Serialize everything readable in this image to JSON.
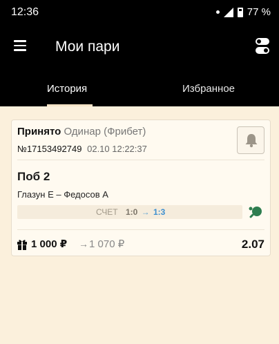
{
  "status_bar": {
    "time": "12:36",
    "battery": "77 %"
  },
  "header": {
    "title": "Мои пари"
  },
  "tabs": [
    {
      "label": "История",
      "active": true
    },
    {
      "label": "Избранное",
      "active": false
    }
  ],
  "bet": {
    "status": "Принято",
    "type": "Одинар (Фрибет)",
    "number": "№17153492749",
    "datetime": "02.10 12:22:37",
    "outcome": "Поб 2",
    "match": "Глазун Е – Федосов А",
    "score_label": "СЧЕТ",
    "score_old": "1:0",
    "score_arrow": "→",
    "score_new": "1:3",
    "stake": "1 000 ₽",
    "payout_arrow": "→",
    "payout": "1 070 ₽",
    "odds": "2.07"
  },
  "colors": {
    "background": "#fbf0dc",
    "header": "#000000",
    "card": "#fffaf0",
    "score_new": "#3d8fcf"
  },
  "icons": {
    "menu": "hamburger-menu-icon",
    "settings": "toggle-settings-icon",
    "bell": "bell-icon",
    "sport": "table-tennis-icon",
    "gift": "gift-icon"
  }
}
